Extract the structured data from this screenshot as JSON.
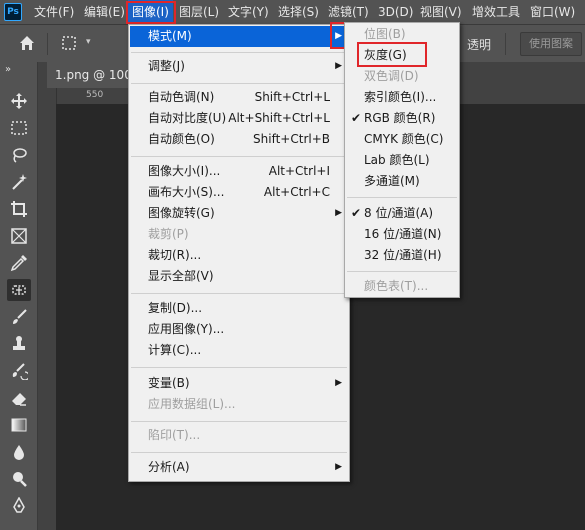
{
  "app": {
    "logo": "Ps"
  },
  "menubar": [
    {
      "label": "文件(F)"
    },
    {
      "label": "编辑(E)"
    },
    {
      "label": "图像(I)"
    },
    {
      "label": "图层(L)"
    },
    {
      "label": "文字(Y)"
    },
    {
      "label": "选择(S)"
    },
    {
      "label": "滤镜(T)"
    },
    {
      "label": "3D(D)"
    },
    {
      "label": "视图(V)"
    },
    {
      "label": "增效工具"
    },
    {
      "label": "窗口(W)"
    }
  ],
  "options_bar": {
    "home_icon": "home-icon",
    "marquee_icon": "marquee-icon",
    "transparent_label": "透明",
    "use_pattern_label": "使用图案"
  },
  "document_tab": {
    "title": "1.png @ 100%"
  },
  "ruler": {
    "mark": "550"
  },
  "image_menu": [
    {
      "label": "模式(M)",
      "submenu": true,
      "highlighted": true
    },
    {
      "label": "调整(J)",
      "submenu": true
    },
    {
      "label": "自动色调(N)",
      "shortcut": "Shift+Ctrl+L"
    },
    {
      "label": "自动对比度(U)",
      "shortcut": "Alt+Shift+Ctrl+L"
    },
    {
      "label": "自动颜色(O)",
      "shortcut": "Shift+Ctrl+B"
    },
    {
      "label": "图像大小(I)...",
      "shortcut": "Alt+Ctrl+I"
    },
    {
      "label": "画布大小(S)...",
      "shortcut": "Alt+Ctrl+C"
    },
    {
      "label": "图像旋转(G)",
      "submenu": true
    },
    {
      "label": "裁剪(P)",
      "disabled": true
    },
    {
      "label": "裁切(R)..."
    },
    {
      "label": "显示全部(V)"
    },
    {
      "label": "复制(D)..."
    },
    {
      "label": "应用图像(Y)..."
    },
    {
      "label": "计算(C)..."
    },
    {
      "label": "变量(B)",
      "submenu": true
    },
    {
      "label": "应用数据组(L)...",
      "disabled": true
    },
    {
      "label": "陷印(T)...",
      "disabled": true
    },
    {
      "label": "分析(A)",
      "submenu": true
    }
  ],
  "mode_submenu": [
    {
      "label": "位图(B)",
      "disabled": true
    },
    {
      "label": "灰度(G)"
    },
    {
      "label": "双色调(D)",
      "disabled": true
    },
    {
      "label": "索引颜色(I)..."
    },
    {
      "label": "RGB 颜色(R)",
      "checked": true
    },
    {
      "label": "CMYK 颜色(C)"
    },
    {
      "label": "Lab 颜色(L)"
    },
    {
      "label": "多通道(M)"
    },
    {
      "label": "8 位/通道(A)",
      "checked": true
    },
    {
      "label": "16 位/通道(N)"
    },
    {
      "label": "32 位/通道(H)"
    },
    {
      "label": "颜色表(T)...",
      "disabled": true
    }
  ],
  "colors": {
    "highlight": "#0a64d8",
    "annotation_red": "#e0262a",
    "ui_panel": "#535353"
  }
}
